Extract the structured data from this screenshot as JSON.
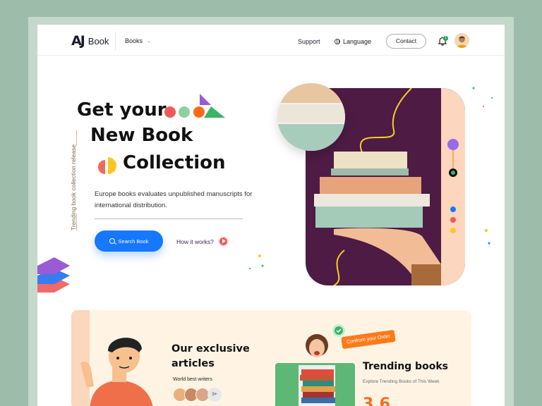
{
  "header": {
    "logo_mark": "AJ",
    "logo_text": "Book",
    "nav_books": "Books",
    "support": "Support",
    "language": "Language",
    "contact": "Contact",
    "notification_count": "1"
  },
  "hero": {
    "title_line1": "Get your",
    "title_line2": "New Book",
    "title_line3": "Collection",
    "vertical_tag": "Trending book collection release",
    "description": "Europe books evaluates unpublished manuscripts for international distribution.",
    "search_button": "Search Book",
    "how_link": "How it works?"
  },
  "articles": {
    "title": "Our  exclusive articles",
    "subtitle": "World best writers",
    "writers_more": "3+"
  },
  "trending": {
    "badge": "Confrom your Order",
    "title": "Trending books",
    "subtitle": "Explore Trending Books of This Week",
    "stat_partial": "3.6"
  },
  "colors": {
    "primary": "#1677ff",
    "panel": "#4d1b44",
    "accent_orange": "#ff7a1a",
    "peach": "#fcd6bd"
  },
  "icons": [
    "globe-icon",
    "chevron-down-icon",
    "bell-icon",
    "search-icon",
    "play-icon",
    "check-icon"
  ]
}
